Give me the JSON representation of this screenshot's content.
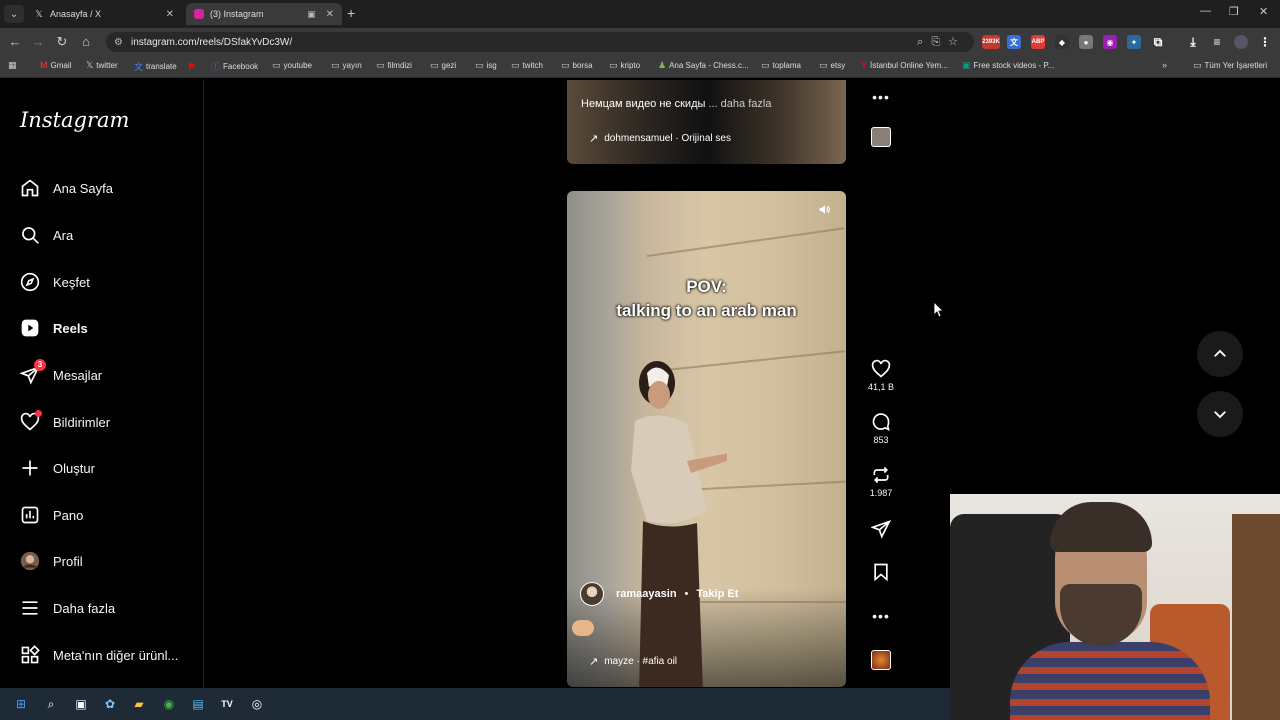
{
  "browser": {
    "tabs": [
      {
        "title": "Anasayfa / X",
        "favicon": "x-icon",
        "active": false
      },
      {
        "title": "(3) Instagram",
        "favicon": "instagram-icon",
        "active": true
      }
    ],
    "url": "instagram.com/reels/DSfakYvDc3W/",
    "extension_badge": "2393K",
    "bookmarks": [
      {
        "label": "Gmail",
        "icon": "gmail-icon"
      },
      {
        "label": "twitter",
        "icon": "x-icon"
      },
      {
        "label": "translate",
        "icon": "translate-icon"
      },
      {
        "label": "",
        "icon": "youtube-icon"
      },
      {
        "label": "Facebook",
        "icon": "facebook-icon"
      },
      {
        "label": "youtube",
        "icon": "folder-icon"
      },
      {
        "label": "yayın",
        "icon": "folder-icon"
      },
      {
        "label": "filmdizi",
        "icon": "folder-icon"
      },
      {
        "label": "gezi",
        "icon": "folder-icon"
      },
      {
        "label": "isg",
        "icon": "folder-icon"
      },
      {
        "label": "twitch",
        "icon": "folder-icon"
      },
      {
        "label": "borsa",
        "icon": "folder-icon"
      },
      {
        "label": "kripto",
        "icon": "folder-icon"
      },
      {
        "label": "Ana Sayfa - Chess.c...",
        "icon": "chess-icon"
      },
      {
        "label": "toplama",
        "icon": "folder-icon"
      },
      {
        "label": "etsy",
        "icon": "folder-icon"
      },
      {
        "label": "İstanbul Online Yem...",
        "icon": "yemeksepeti-icon"
      },
      {
        "label": "Free stock videos - P...",
        "icon": "pexels-icon"
      }
    ],
    "all_bookmarks": "Tüm Yer İşaretleri"
  },
  "instagram": {
    "logo": "Instagram",
    "nav": [
      {
        "label": "Ana Sayfa",
        "icon": "home-icon"
      },
      {
        "label": "Ara",
        "icon": "search-icon"
      },
      {
        "label": "Keşfet",
        "icon": "compass-icon"
      },
      {
        "label": "Reels",
        "icon": "reels-icon"
      },
      {
        "label": "Mesajlar",
        "icon": "messenger-icon",
        "badge": "3"
      },
      {
        "label": "Bildirimler",
        "icon": "heart-icon"
      },
      {
        "label": "Oluştur",
        "icon": "plus-icon"
      },
      {
        "label": "Pano",
        "icon": "dashboard-icon"
      },
      {
        "label": "Profil",
        "icon": "avatar-icon"
      },
      {
        "label": "Daha fazla",
        "icon": "menu-icon"
      },
      {
        "label": "Meta'nın diğer ürünl...",
        "icon": "grid-icon"
      }
    ],
    "prev_reel": {
      "caption": "Немцам видео не скиды",
      "more": "... daha fazla",
      "audio": "dohmensamuel · Orijinal ses"
    },
    "reel": {
      "text_line1": "POV:",
      "text_line2": "talking to an arab man",
      "username": "ramaayasin",
      "follow": "Takip Et",
      "audio": "mayze · #afia oil",
      "likes": "41,1 B",
      "comments": "853",
      "reposts": "1.987"
    }
  },
  "colors": {
    "accent_red": "#ff3040",
    "background": "#000000"
  }
}
